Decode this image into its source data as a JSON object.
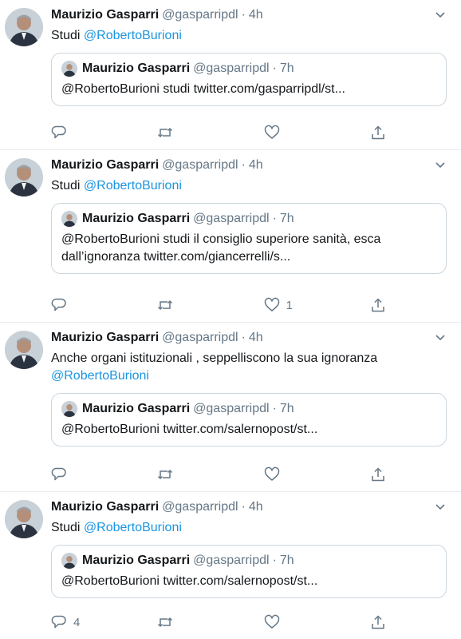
{
  "tweets": [
    {
      "name": "Maurizio Gasparri",
      "handle": "@gasparripdl",
      "time": "4h",
      "text_before": "Studi ",
      "mention": "@RobertoBurioni",
      "text_after": "",
      "quote": {
        "name": "Maurizio Gasparri",
        "handle": "@gasparripdl",
        "time": "7h",
        "text": "@RobertoBurioni studi twitter.com/gasparripdl/st..."
      },
      "counts": {
        "reply": "",
        "retweet": "",
        "like": ""
      }
    },
    {
      "name": "Maurizio Gasparri",
      "handle": "@gasparripdl",
      "time": "4h",
      "text_before": "Studi ",
      "mention": "@RobertoBurioni",
      "text_after": "",
      "quote": {
        "name": "Maurizio Gasparri",
        "handle": "@gasparripdl",
        "time": "7h",
        "text": "@RobertoBurioni studi il consiglio superiore sanità, esca dall’ignoranza twitter.com/giancerrelli/s..."
      },
      "counts": {
        "reply": "",
        "retweet": "",
        "like": "1"
      }
    },
    {
      "name": "Maurizio Gasparri",
      "handle": "@gasparripdl",
      "time": "4h",
      "text_before": "Anche organi istituzionali , seppelliscono la sua ignoranza ",
      "mention": "@RobertoBurioni",
      "text_after": "",
      "quote": {
        "name": "Maurizio Gasparri",
        "handle": "@gasparripdl",
        "time": "7h",
        "text": "@RobertoBurioni twitter.com/salernopost/st..."
      },
      "counts": {
        "reply": "",
        "retweet": "",
        "like": ""
      }
    },
    {
      "name": "Maurizio Gasparri",
      "handle": "@gasparripdl",
      "time": "4h",
      "text_before": "Studi ",
      "mention": "@RobertoBurioni",
      "text_after": "",
      "quote": {
        "name": "Maurizio Gasparri",
        "handle": "@gasparripdl",
        "time": "7h",
        "text": "@RobertoBurioni twitter.com/salernopost/st..."
      },
      "counts": {
        "reply": "4",
        "retweet": "",
        "like": ""
      }
    }
  ],
  "separator": "·",
  "icons": {
    "reply": "reply-icon",
    "retweet": "retweet-icon",
    "like": "like-icon",
    "share": "share-icon",
    "menu": "chevron-down-icon"
  },
  "colors": {
    "link": "#1b95e0",
    "muted": "#657786",
    "border": "#ccd6dd"
  }
}
